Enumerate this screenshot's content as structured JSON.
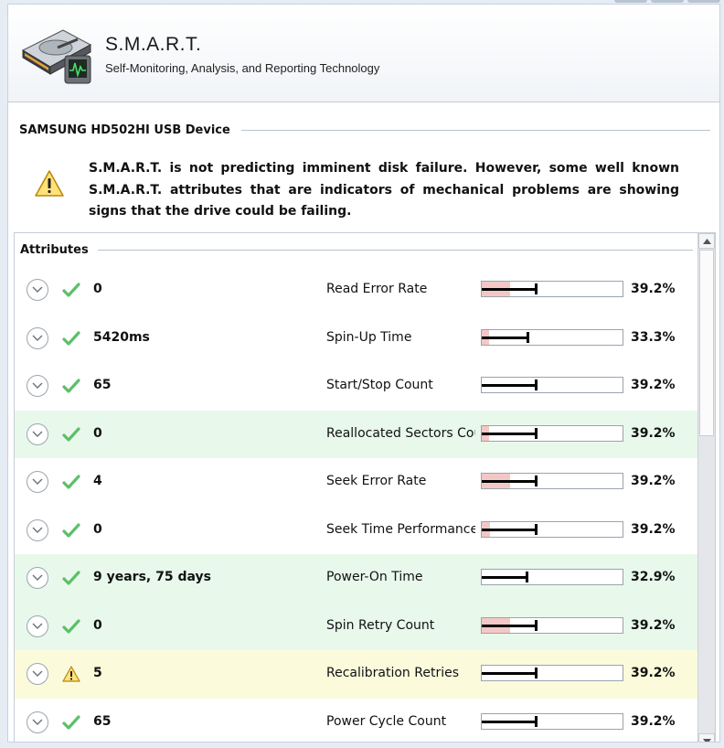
{
  "app": {
    "title": "S.M.A.R.T.",
    "subtitle": "Self-Monitoring, Analysis, and Reporting Technology"
  },
  "device": {
    "name": "SAMSUNG HD502HI USB Device"
  },
  "warning": {
    "text": "S.M.A.R.T. is not predicting imminent disk failure. However, some well known S.M.A.R.T. attributes that are indicators of mechanical problems are showing signs that the drive could be failing."
  },
  "attributes": {
    "title": "Attributes",
    "rows": [
      {
        "value": "0",
        "name": "Read Error Rate",
        "percent": "39.2%",
        "status": "ok",
        "highlight": "none",
        "level": 0.392,
        "pink": 0.2
      },
      {
        "value": "5420ms",
        "name": "Spin-Up Time",
        "percent": "33.3%",
        "status": "ok",
        "highlight": "none",
        "level": 0.333,
        "pink": 0.05
      },
      {
        "value": "65",
        "name": "Start/Stop Count",
        "percent": "39.2%",
        "status": "ok",
        "highlight": "none",
        "level": 0.392,
        "pink": 0
      },
      {
        "value": "0",
        "name": "Reallocated Sectors Count",
        "percent": "39.2%",
        "status": "ok",
        "highlight": "green",
        "level": 0.392,
        "pink": 0.05
      },
      {
        "value": "4",
        "name": "Seek Error Rate",
        "percent": "39.2%",
        "status": "ok",
        "highlight": "none",
        "level": 0.392,
        "pink": 0.2
      },
      {
        "value": "0",
        "name": "Seek Time Performance",
        "percent": "39.2%",
        "status": "ok",
        "highlight": "none",
        "level": 0.392,
        "pink": 0.06
      },
      {
        "value": "9 years, 75 days",
        "name": "Power-On Time",
        "percent": "32.9%",
        "status": "ok",
        "highlight": "green",
        "level": 0.329,
        "pink": 0
      },
      {
        "value": "0",
        "name": "Spin Retry Count",
        "percent": "39.2%",
        "status": "ok",
        "highlight": "green",
        "level": 0.392,
        "pink": 0.2
      },
      {
        "value": "5",
        "name": "Recalibration Retries",
        "percent": "39.2%",
        "status": "warning",
        "highlight": "yellow",
        "level": 0.392,
        "pink": 0
      },
      {
        "value": "65",
        "name": "Power Cycle Count",
        "percent": "39.2%",
        "status": "ok",
        "highlight": "none",
        "level": 0.392,
        "pink": 0
      }
    ]
  },
  "icons": {
    "app": "hard-disk-monitor-icon",
    "warning": "warning-triangle-icon",
    "ok": "check-icon",
    "expand": "chevron-down-icon"
  },
  "colors": {
    "ok": "#5cbf6a",
    "warning": "#f2c230",
    "row_green": "#e8f9ec",
    "row_yellow": "#fbfbdc",
    "bar_pink": "#f4c7c7"
  }
}
